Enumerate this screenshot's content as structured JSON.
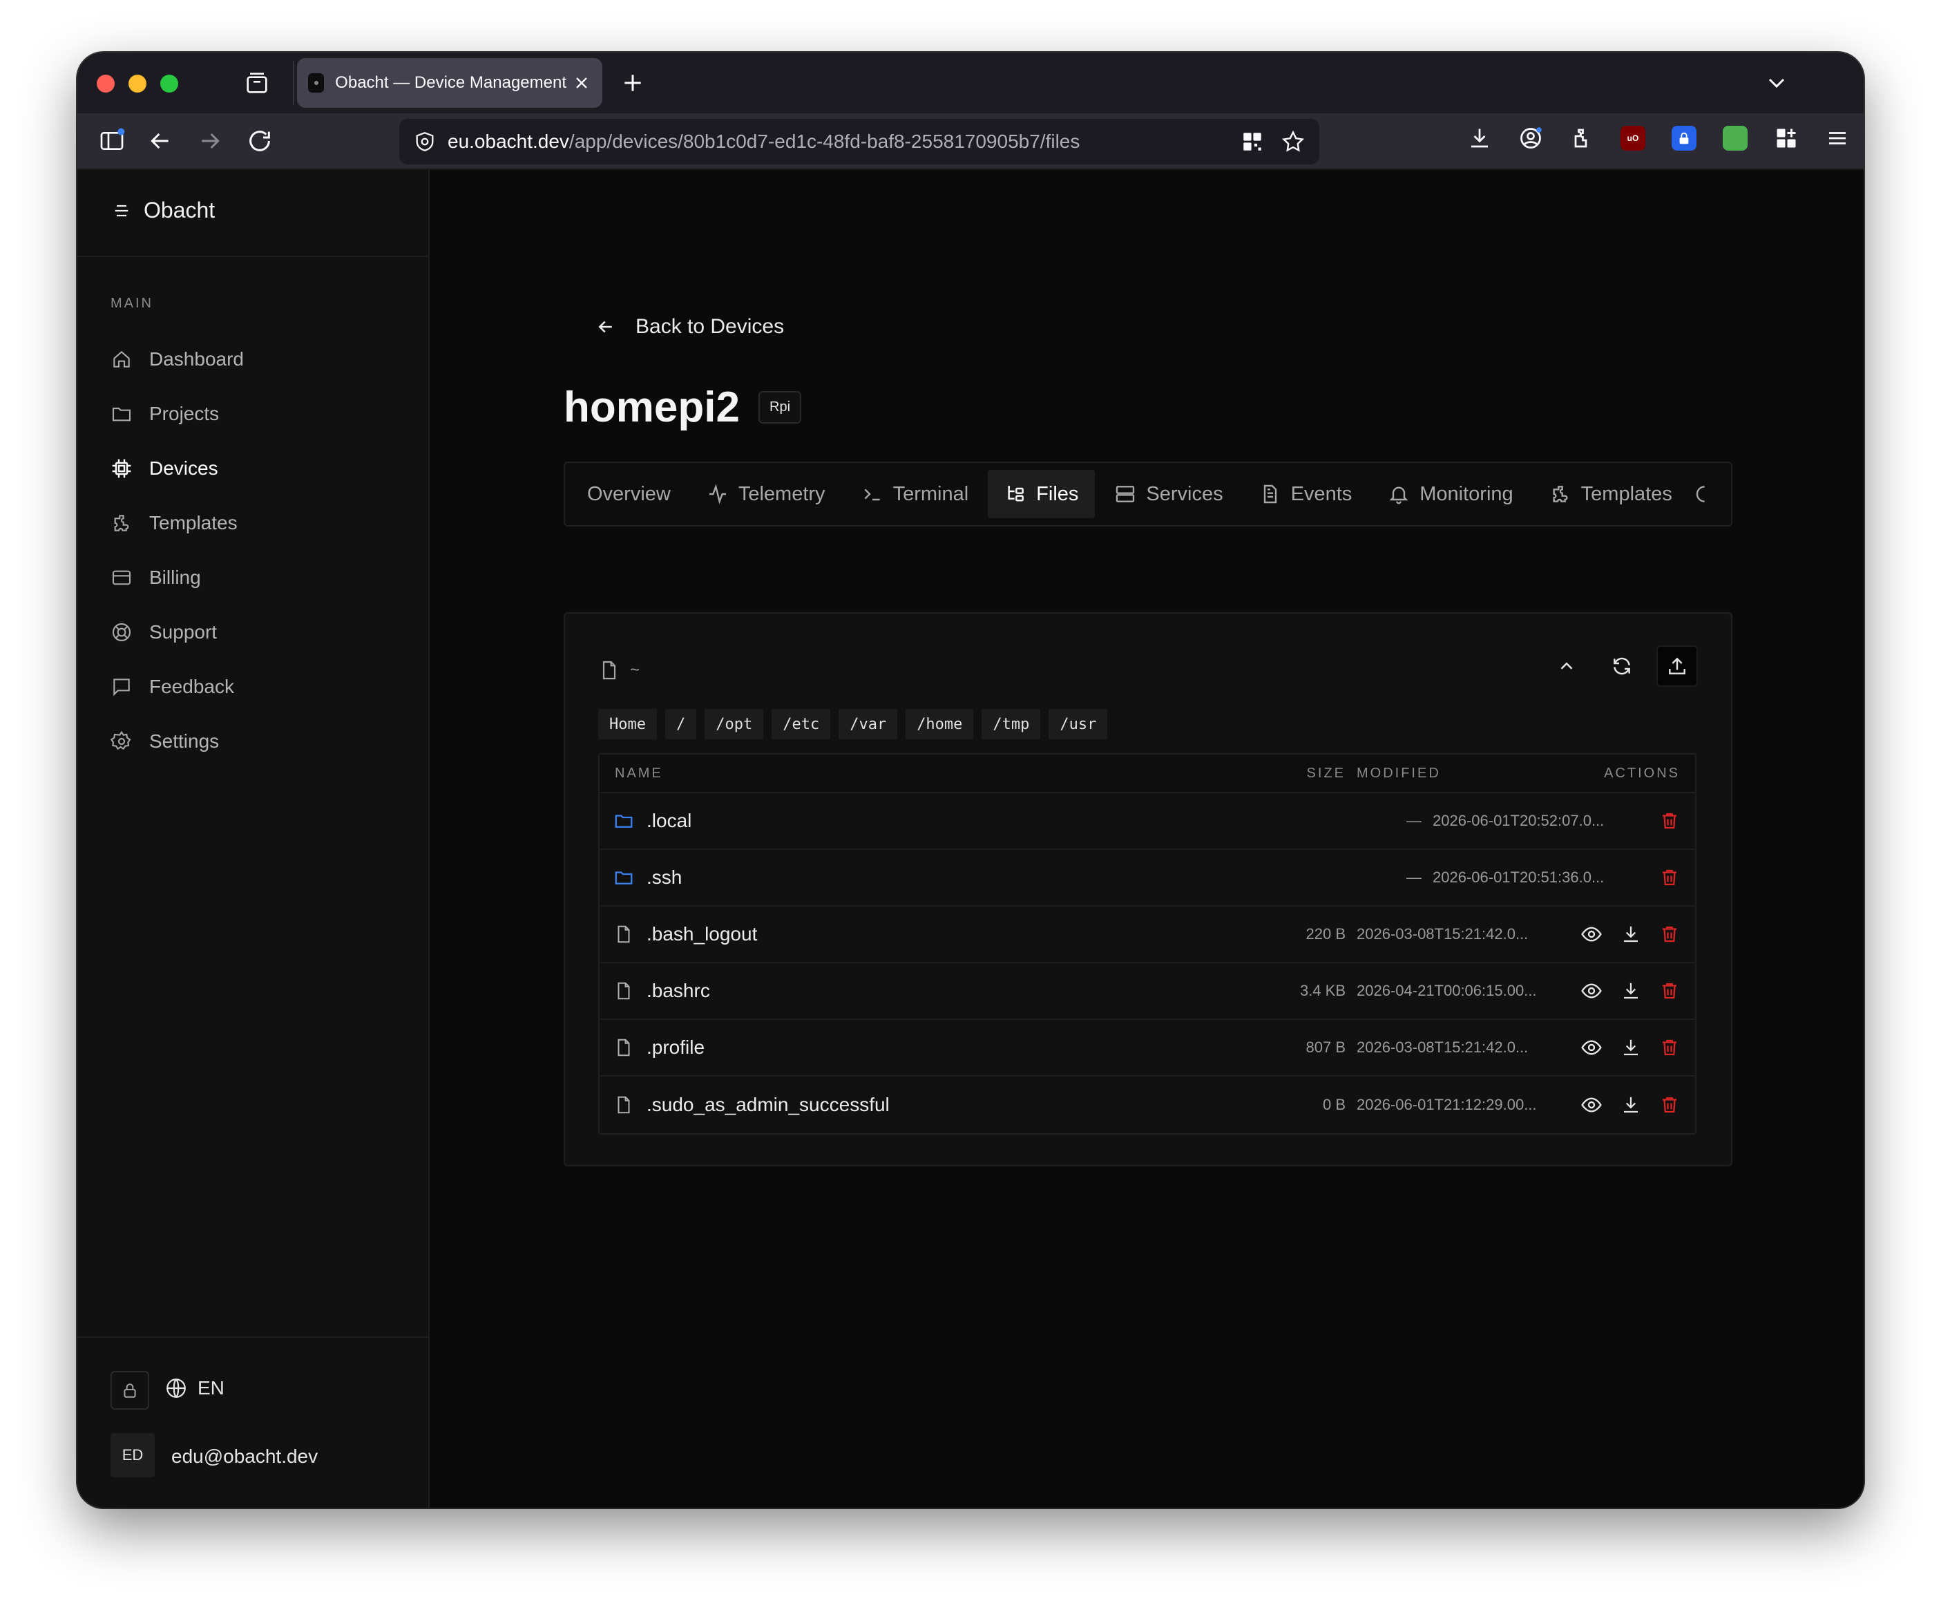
{
  "browser": {
    "tab_title": "Obacht — Device Management",
    "url_host": "eu.obacht.dev",
    "url_path": "/app/devices/80b1c0d7-ed1c-48fd-baf8-2558170905b7/files"
  },
  "sidebar": {
    "brand": "Obacht",
    "section": "MAIN",
    "items": [
      {
        "label": "Dashboard",
        "icon": "home-icon"
      },
      {
        "label": "Projects",
        "icon": "folder-icon"
      },
      {
        "label": "Devices",
        "icon": "chip-icon",
        "active": true
      },
      {
        "label": "Templates",
        "icon": "puzzle-icon"
      },
      {
        "label": "Billing",
        "icon": "credit-card-icon"
      },
      {
        "label": "Support",
        "icon": "lifebuoy-icon"
      },
      {
        "label": "Feedback",
        "icon": "message-icon"
      },
      {
        "label": "Settings",
        "icon": "gear-icon"
      }
    ],
    "language": "EN",
    "user_initials": "ED",
    "user_email": "edu@obacht.dev"
  },
  "main": {
    "back_label": "Back to Devices",
    "device_name": "homepi2",
    "device_badge": "Rpi",
    "tabs": [
      {
        "label": "Overview"
      },
      {
        "label": "Telemetry"
      },
      {
        "label": "Terminal"
      },
      {
        "label": "Files",
        "active": true
      },
      {
        "label": "Services"
      },
      {
        "label": "Events"
      },
      {
        "label": "Monitoring"
      },
      {
        "label": "Templates"
      }
    ],
    "files": {
      "current_path": "~",
      "breadcrumbs": [
        "Home",
        "/",
        "/opt",
        "/etc",
        "/var",
        "/home",
        "/tmp",
        "/usr"
      ],
      "columns": {
        "name": "NAME",
        "size": "SIZE",
        "modified": "MODIFIED",
        "actions": "ACTIONS"
      },
      "rows": [
        {
          "name": ".local",
          "type": "dir",
          "size": "—",
          "modified": "2026-06-01T20:52:07.0..."
        },
        {
          "name": ".ssh",
          "type": "dir",
          "size": "—",
          "modified": "2026-06-01T20:51:36.0..."
        },
        {
          "name": ".bash_logout",
          "type": "file",
          "size": "220 B",
          "modified": "2026-03-08T15:21:42.0..."
        },
        {
          "name": ".bashrc",
          "type": "file",
          "size": "3.4 KB",
          "modified": "2026-04-21T00:06:15.00..."
        },
        {
          "name": ".profile",
          "type": "file",
          "size": "807 B",
          "modified": "2026-03-08T15:21:42.0..."
        },
        {
          "name": ".sudo_as_admin_successful",
          "type": "file",
          "size": "0 B",
          "modified": "2026-06-01T21:12:29.00..."
        }
      ]
    }
  },
  "colors": {
    "folder": "#3b82f6",
    "danger": "#dc2626"
  }
}
